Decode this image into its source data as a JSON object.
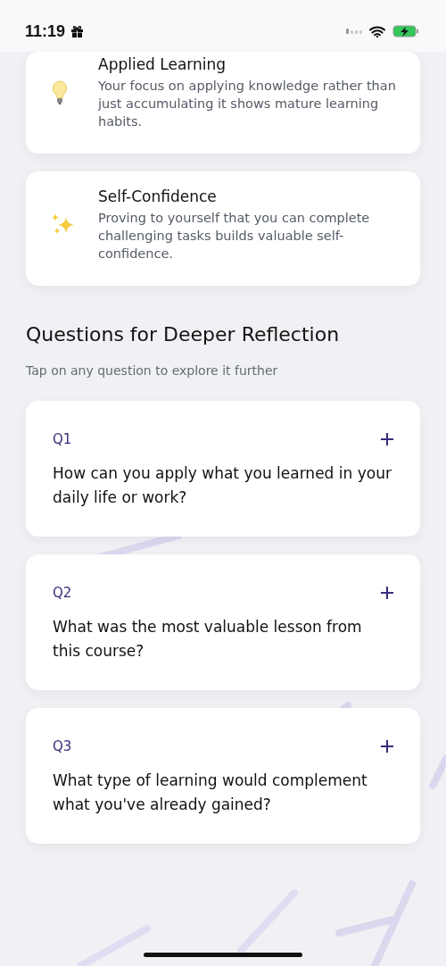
{
  "status_bar": {
    "time": "11:19"
  },
  "insights": [
    {
      "kind": "lightbulb",
      "title": "Applied Learning",
      "text": "Your focus on applying knowledge rather than just accumulating it shows mature learning habits."
    },
    {
      "kind": "sparkles",
      "title": "Self-Confidence",
      "text": "Proving to yourself that you can complete challenging tasks builds valuable self-confidence."
    }
  ],
  "section": {
    "title": "Questions for Deeper Reflection",
    "subtitle": "Tap on any question to explore it further"
  },
  "questions": [
    {
      "label": "Q1",
      "text": "How can you apply what you learned in your daily life or work?",
      "expanded": false
    },
    {
      "label": "Q2",
      "text": "What was the most valuable lesson from this course?",
      "expanded": false
    },
    {
      "label": "Q3",
      "text": "What type of learning would complement what you've already gained?",
      "expanded": false
    }
  ]
}
